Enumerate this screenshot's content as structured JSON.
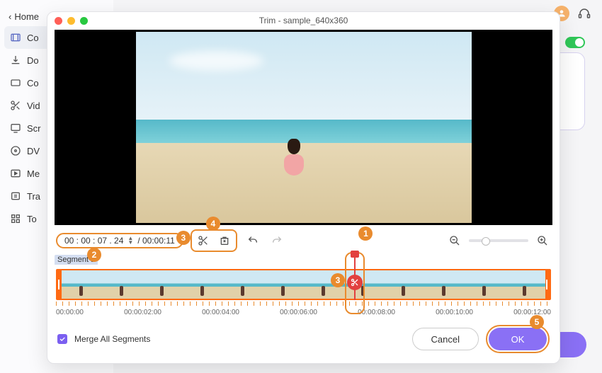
{
  "window": {
    "title": "Trim - sample_640x360"
  },
  "sidebar": {
    "back": "Home",
    "items": [
      {
        "label": "Co"
      },
      {
        "label": "Do"
      },
      {
        "label": "Co"
      },
      {
        "label": "Vid"
      },
      {
        "label": "Scr"
      },
      {
        "label": "DV"
      },
      {
        "label": "Me"
      },
      {
        "label": "Tra"
      },
      {
        "label": "To"
      }
    ]
  },
  "time": {
    "current": "00 : 00 : 07 . 24",
    "total": "/ 00:00:11"
  },
  "timeline": {
    "segment_label": "Segment 1",
    "ticks": [
      "00:00:00",
      "00:00:02:00",
      "00:00:04:00",
      "00:00:06:00",
      "00:00:08:00",
      "00:00:10:00",
      "00:00:12:00"
    ]
  },
  "footer": {
    "merge_label": "Merge All Segments",
    "cancel": "Cancel",
    "ok": "OK"
  },
  "annotations": {
    "b1": "1",
    "b2": "2",
    "b3": "3",
    "b3b": "3",
    "b4": "4",
    "b5": "5"
  }
}
